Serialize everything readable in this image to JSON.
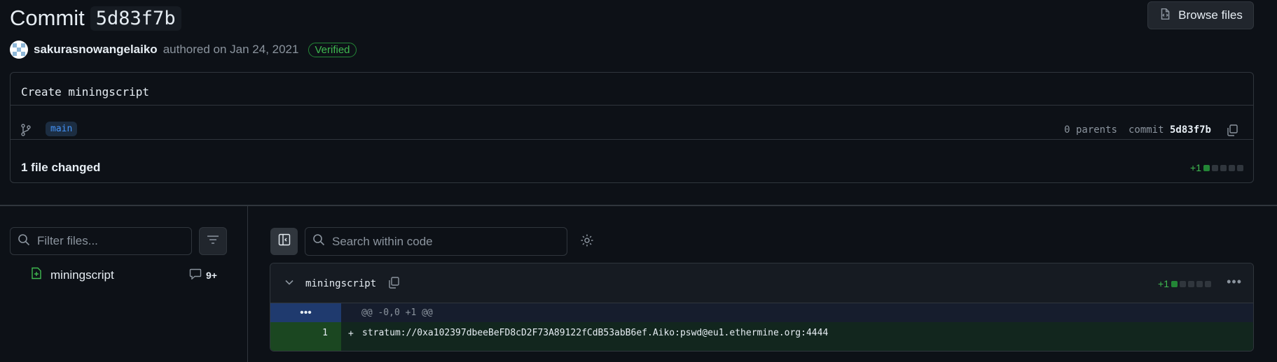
{
  "header": {
    "title_word": "Commit",
    "sha": "5d83f7b",
    "browse_files_label": "Browse files"
  },
  "author": {
    "name": "sakurasnowangelaiko",
    "meta": "authored on Jan 24, 2021",
    "badge": "Verified"
  },
  "commit": {
    "message": "Create miningscript",
    "branch": "main",
    "parents_label": "0 parents",
    "commit_label": "commit",
    "commit_sha": "5d83f7b",
    "files_changed": "1 file changed",
    "additions": "+1"
  },
  "sidebar": {
    "filter_placeholder": "Filter files...",
    "file_name": "miningscript",
    "comment_count": "9+"
  },
  "diff": {
    "search_placeholder": "Search within code",
    "file_name": "miningscript",
    "additions": "+1",
    "more_label": "•••",
    "hunk_expand": "•••",
    "hunk_header": "@@ -0,0 +1 @@",
    "line_number": "1",
    "line_sign": "+",
    "line_code": "stratum://0xa102397dbeeBeFD8cD2F73A89122fCdB53abB6ef.Aiko:pswd@eu1.ethermine.org:4444"
  },
  "colors": {
    "background": "#0d1117",
    "border": "#30363d",
    "accent_green": "#3fb950",
    "accent_blue": "#4493f8"
  }
}
